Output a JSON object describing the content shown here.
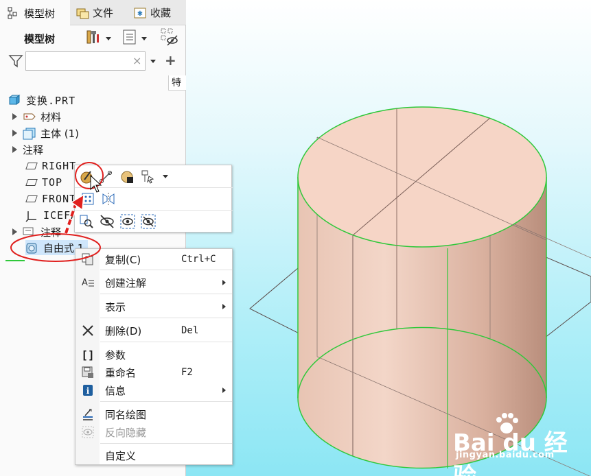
{
  "tabs": [
    {
      "label": "模型树",
      "icon": "model-tree-icon"
    },
    {
      "label": "文件",
      "icon": "folder-icon"
    },
    {
      "label": "收藏",
      "icon": "favorites-icon"
    }
  ],
  "toolbar": {
    "title": "模型树",
    "buttons": [
      "settings-tools-icon",
      "tree-display-icon",
      "show-hide-icon"
    ]
  },
  "search": {
    "value": "",
    "clear": "×"
  },
  "column_header": "特",
  "tree": {
    "root": "变换.PRT",
    "items": [
      "材料",
      "主体 (1)",
      "注释",
      "RIGHT",
      "TOP",
      "FRONT",
      "ICEFA",
      "注释",
      "自由式 1"
    ]
  },
  "mini_toolbar": {
    "rows": [
      [
        "appearance-icon",
        "edit-sketch-icon",
        "material-icon",
        "selection-filter-icon"
      ],
      [
        "pattern-icon",
        "mirror-icon"
      ],
      [
        "find-icon",
        "hide-icon",
        "show-icon",
        "hide-others-icon"
      ]
    ]
  },
  "context_menu": {
    "items": [
      {
        "label": "复制(C)",
        "shortcut": "Ctrl+C",
        "icon": "copy-icon"
      },
      {
        "label": "创建注解",
        "shortcut": "",
        "icon": "annotation-icon",
        "submenu": true
      },
      {
        "label": "表示",
        "shortcut": "",
        "icon": "",
        "submenu": true
      },
      {
        "label": "删除(D)",
        "shortcut": "Del",
        "icon": "delete-icon"
      },
      {
        "label": "参数",
        "shortcut": "",
        "icon": "parameters-icon"
      },
      {
        "label": "重命名",
        "shortcut": "F2",
        "icon": "rename-icon"
      },
      {
        "label": "信息",
        "shortcut": "",
        "icon": "info-icon",
        "submenu": true
      },
      {
        "label": "同名绘图",
        "shortcut": "",
        "icon": "drawing-icon"
      },
      {
        "label": "反向隐藏",
        "shortcut": "",
        "icon": "reverse-hide-icon",
        "disabled": true
      },
      {
        "label": "自定义",
        "shortcut": "",
        "icon": ""
      }
    ]
  },
  "watermark": {
    "logo": "Bai du 经验",
    "url": "jingyan.baidu.com"
  },
  "colors": {
    "highlight_red": "#e0201e",
    "cylinder_fill": "#f3d3c4",
    "edge_green": "#2fc83a",
    "viewport_bg": "#8ce6f4",
    "selected_item_bg": "#cfe6fb"
  }
}
